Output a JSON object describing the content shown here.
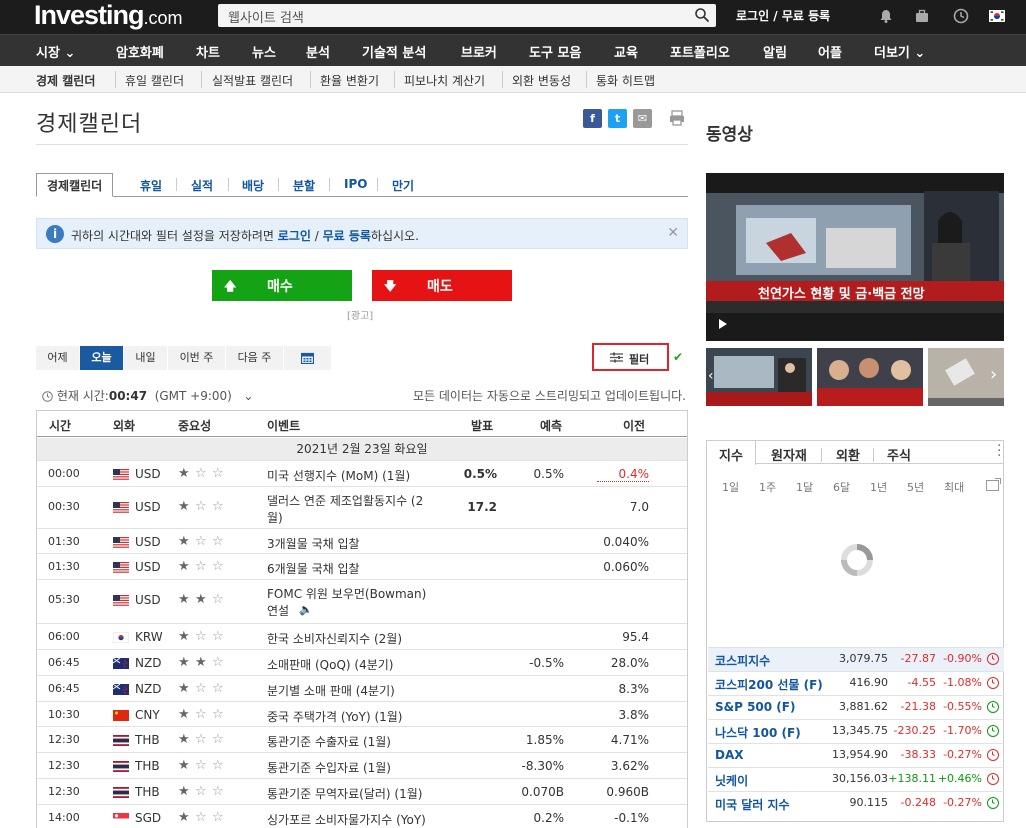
{
  "header": {
    "logo_main": "Investing",
    "logo_suffix": ".com",
    "search_placeholder": "웹사이트 검색",
    "login_text": "로그인 / 무료 등록"
  },
  "nav": {
    "items": [
      "시장",
      "암호화폐",
      "차트",
      "뉴스",
      "분석",
      "기술적 분석",
      "브로커",
      "도구 모음",
      "교육",
      "포트폴리오",
      "알림",
      "어플",
      "더보기"
    ]
  },
  "subnav": {
    "items": [
      "경제 캘린더",
      "휴일 캘린더",
      "실적발표 캘린더",
      "환율 변환기",
      "피보나치 계산기",
      "외환 변동성",
      "통화 히트맵"
    ]
  },
  "page": {
    "title": "경제캘린더",
    "share_icons": [
      "facebook-icon",
      "twitter-icon",
      "email-icon",
      "print-icon"
    ]
  },
  "tabs": [
    "경제캘린더",
    "휴일",
    "실적",
    "배당",
    "분할",
    "IPO",
    "만기"
  ],
  "info": {
    "text_before": "귀하의 시간대와 필터 설정을 저장하려면",
    "login_link": "로그인",
    "slash": " / ",
    "register_link": "무료 등록",
    "text_after": "하십시오."
  },
  "trade": {
    "buy": "매수",
    "sell": "매도",
    "ad": "[광고]"
  },
  "date_selector": [
    "어제",
    "오늘",
    "내일",
    "이번 주",
    "다음 주"
  ],
  "filter_label": "필터",
  "time": {
    "label": "현재 시간:",
    "value": "00:47",
    "tz": "(GMT +9:00)",
    "auto_update": "모든 데이터는 자동으로 스트리밍되고 업데이트됩니다."
  },
  "table": {
    "headers": [
      "시간",
      "외화",
      "중요성",
      "이벤트",
      "발표",
      "예측",
      "이전"
    ],
    "date_header": "2021년 2월 23일 화요일",
    "rows": [
      {
        "time": "00:00",
        "cur": "USD",
        "flag": "us",
        "imp": 1,
        "event": "미국 선행지수 (MoM) (1월)",
        "actual": "0.5%",
        "forecast": "0.5%",
        "previous": "0.4%",
        "prev_color": "#e12c2c"
      },
      {
        "time": "00:30",
        "cur": "USD",
        "flag": "us",
        "imp": 1,
        "event": "댈러스 연준 제조업활동지수 (2",
        "event2": "월)",
        "actual": "17.2",
        "forecast": "",
        "previous": "7.0",
        "prev_color": "#333"
      },
      {
        "time": "01:30",
        "cur": "USD",
        "flag": "us",
        "imp": 1,
        "event": "3개월물 국채 입찰",
        "actual": "",
        "forecast": "",
        "previous": "0.040%",
        "prev_color": "#333"
      },
      {
        "time": "01:30",
        "cur": "USD",
        "flag": "us",
        "imp": 1,
        "event": "6개월물 국채 입찰",
        "actual": "",
        "forecast": "",
        "previous": "0.060%",
        "prev_color": "#333"
      },
      {
        "time": "05:30",
        "cur": "USD",
        "flag": "us",
        "imp": 2,
        "event": "FOMC 위원 보우먼(Bowman)",
        "event2": "연설",
        "actual": "",
        "forecast": "",
        "previous": "",
        "prev_color": "#333"
      },
      {
        "time": "06:00",
        "cur": "KRW",
        "flag": "kr",
        "imp": 1,
        "event": "한국 소비자신뢰지수 (2월)",
        "actual": "",
        "forecast": "",
        "previous": "95.4",
        "prev_color": "#333"
      },
      {
        "time": "06:45",
        "cur": "NZD",
        "flag": "nz",
        "imp": 2,
        "event": "소매판매 (QoQ) (4분기)",
        "actual": "",
        "forecast": "-0.5%",
        "previous": "28.0%",
        "prev_color": "#333"
      },
      {
        "time": "06:45",
        "cur": "NZD",
        "flag": "nz",
        "imp": 1,
        "event": "분기별 소매 판매 (4분기)",
        "actual": "",
        "forecast": "",
        "previous": "8.3%",
        "prev_color": "#333"
      },
      {
        "time": "10:30",
        "cur": "CNY",
        "flag": "cn",
        "imp": 1,
        "event": "중국 주택가격 (YoY) (1월)",
        "actual": "",
        "forecast": "",
        "previous": "3.8%",
        "prev_color": "#333"
      },
      {
        "time": "12:30",
        "cur": "THB",
        "flag": "th",
        "imp": 1,
        "event": "통관기준 수출자료 (1월)",
        "actual": "",
        "forecast": "1.85%",
        "previous": "4.71%",
        "prev_color": "#333"
      },
      {
        "time": "12:30",
        "cur": "THB",
        "flag": "th",
        "imp": 1,
        "event": "통관기준 수입자료 (1월)",
        "actual": "",
        "forecast": "-8.30%",
        "previous": "3.62%",
        "prev_color": "#333"
      },
      {
        "time": "12:30",
        "cur": "THB",
        "flag": "th",
        "imp": 1,
        "event": "통관기준 무역자료(달러) (1월)",
        "actual": "",
        "forecast": "0.070B",
        "previous": "0.960B",
        "prev_color": "#333"
      },
      {
        "time": "14:00",
        "cur": "SGD",
        "flag": "sg",
        "imp": 1,
        "event": "싱가포르 소비자물가지수 (YoY)",
        "actual": "",
        "forecast": "0.2%",
        "previous": "-0.1%",
        "prev_color": "#333"
      }
    ]
  },
  "video": {
    "title": "동영상",
    "caption": "천연가스 현황 및 금·백금 전망"
  },
  "markets": {
    "tabs": [
      "지수",
      "원자재",
      "외환",
      "주식"
    ],
    "periods": [
      "1일",
      "1주",
      "1달",
      "6달",
      "1년",
      "5년",
      "최대"
    ],
    "rows": [
      {
        "name": "코스피지수",
        "last": "3,079.75",
        "chg": "-27.87",
        "pct": "-0.90%",
        "dir": "neg",
        "clock": "red"
      },
      {
        "name": "코스피200 선물 (F)",
        "last": "416.90",
        "chg": "-4.55",
        "pct": "-1.08%",
        "dir": "neg",
        "clock": "red"
      },
      {
        "name": "S&P 500 (F)",
        "last": "3,881.62",
        "chg": "-21.38",
        "pct": "-0.55%",
        "dir": "neg",
        "clock": "green"
      },
      {
        "name": "나스닥 100 (F)",
        "last": "13,345.75",
        "chg": "-230.25",
        "pct": "-1.70%",
        "dir": "neg",
        "clock": "green"
      },
      {
        "name": "DAX",
        "last": "13,954.90",
        "chg": "-38.33",
        "pct": "-0.27%",
        "dir": "neg",
        "clock": "red"
      },
      {
        "name": "닛케이",
        "last": "30,156.03",
        "chg": "+138.11",
        "pct": "+0.46%",
        "dir": "pos",
        "clock": "red"
      },
      {
        "name": "미국 달러 지수",
        "last": "90.115",
        "chg": "-0.248",
        "pct": "-0.27%",
        "dir": "neg",
        "clock": "green"
      }
    ]
  }
}
